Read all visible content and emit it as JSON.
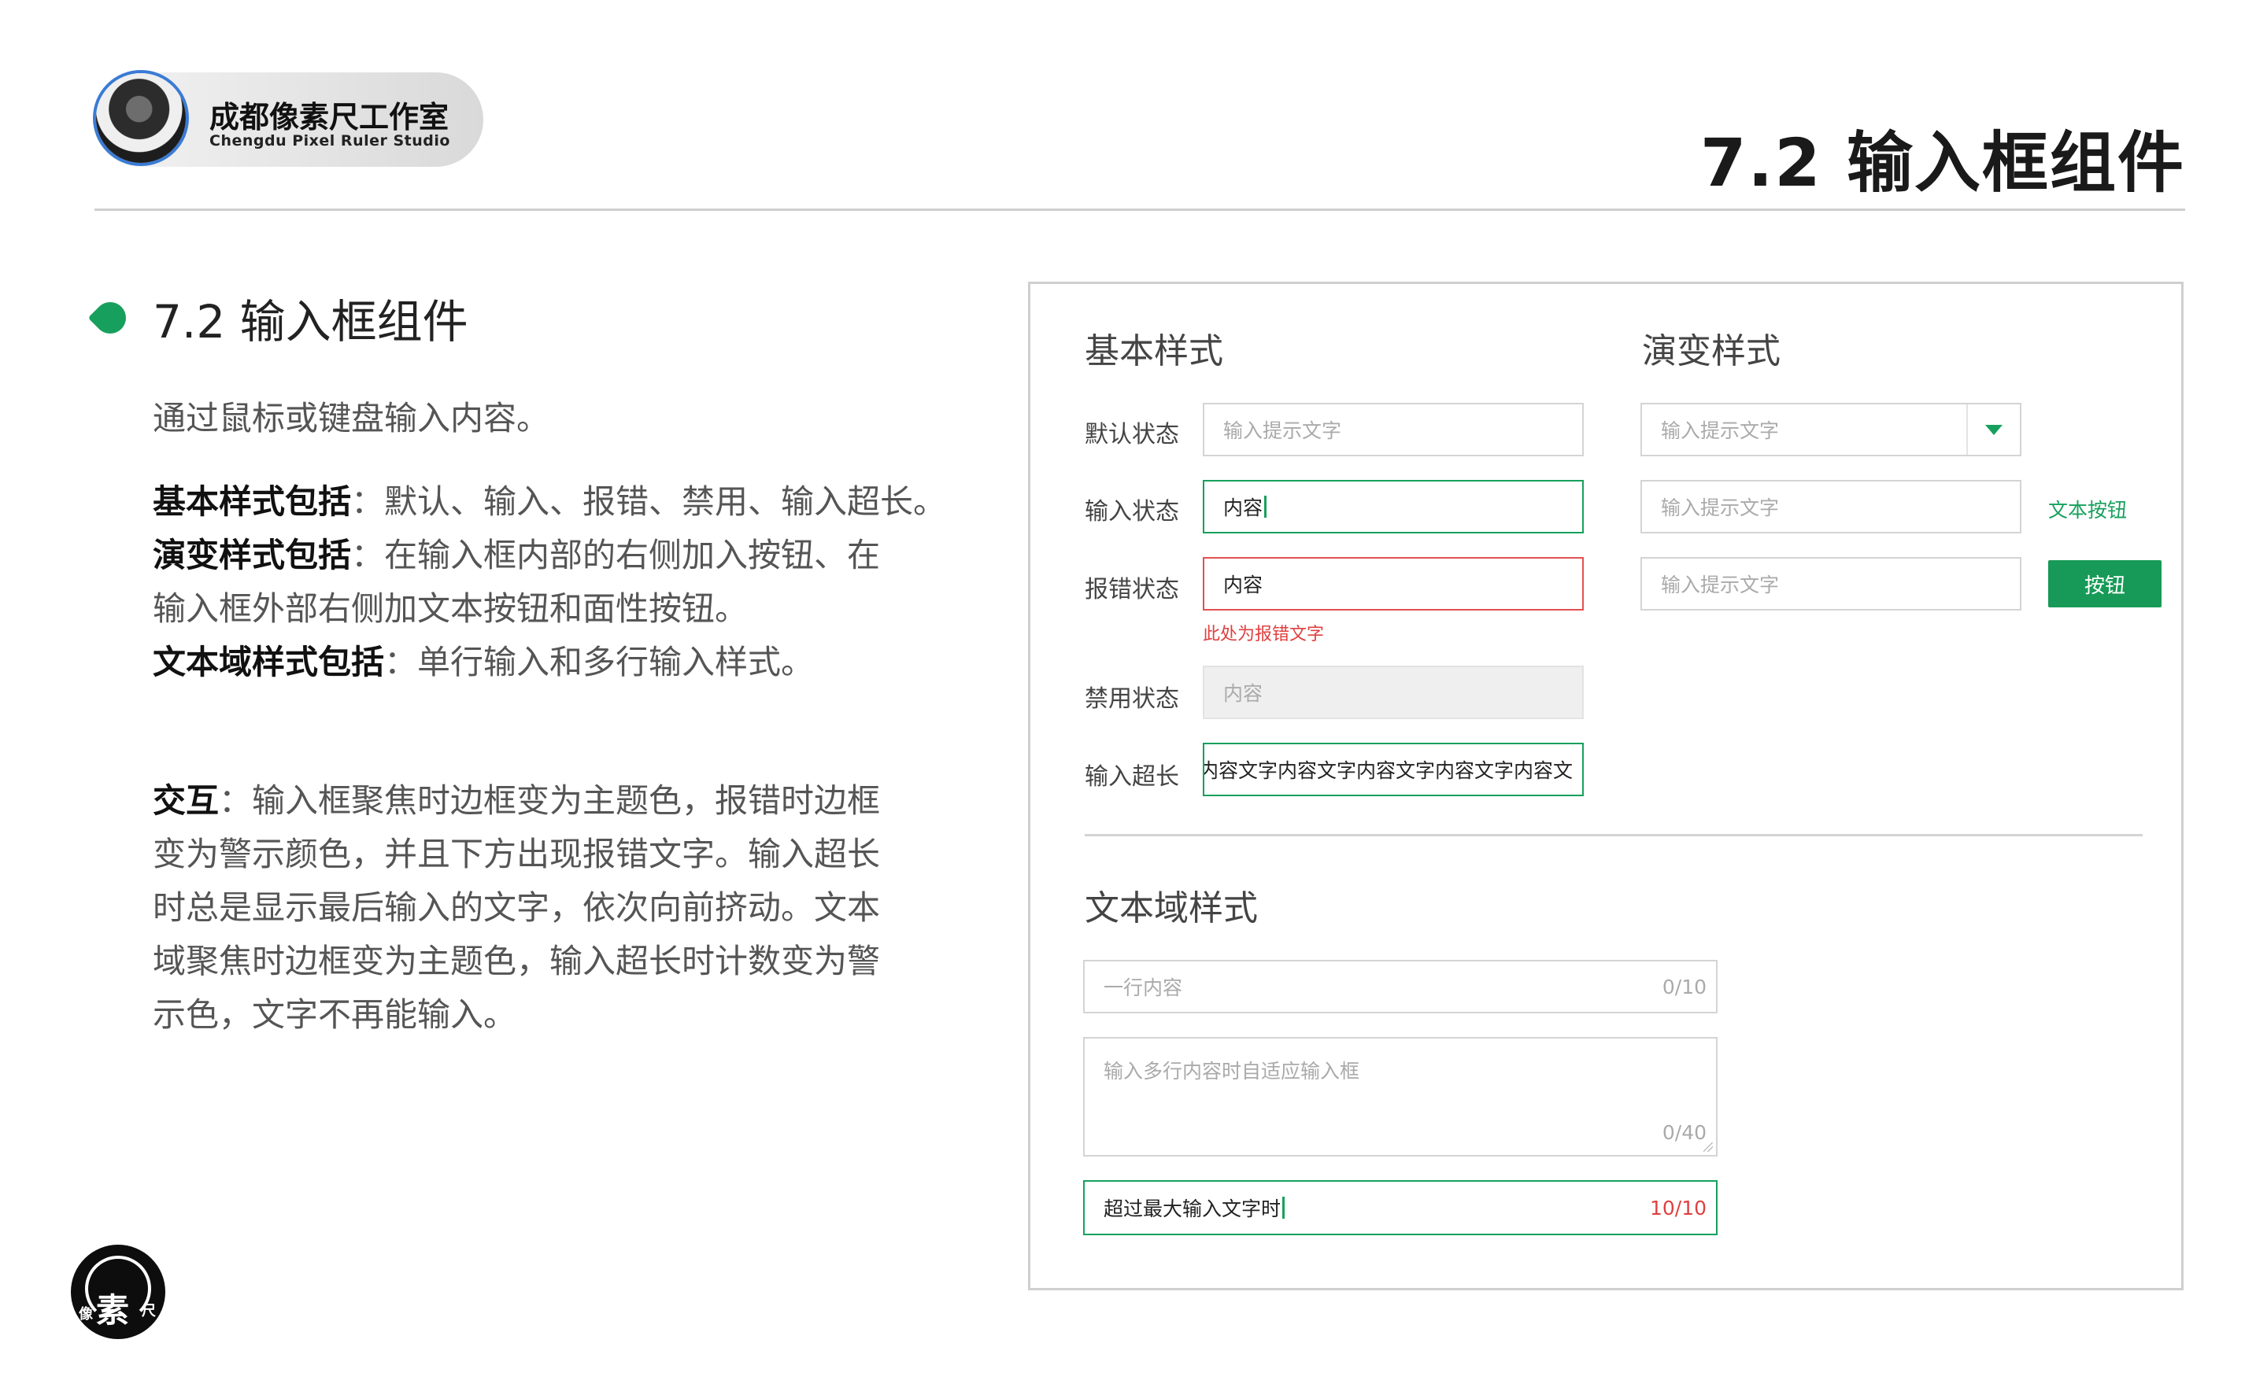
{
  "header": {
    "studio_name": "成都像素尺工作室",
    "studio_name_en": "Chengdu Pixel Ruler Studio",
    "page_title": "7.2 输入框组件"
  },
  "section": {
    "title": "7.2 输入框组件",
    "intro": "通过鼠标或键盘输入内容。",
    "basic_label": "基本样式包括",
    "basic_text": "：默认、输入、报错、禁用、输入超长。",
    "variant_label": "演变样式包括",
    "variant_text_1": "：在输入框内部的右侧加入按钮、在",
    "variant_text_2": "输入框外部右侧加文本按钮和面性按钮。",
    "textarea_label": "文本域样式包括",
    "textarea_text": "：单行输入和多行输入样式。",
    "interaction_label": "交互",
    "interaction_text_1": "：输入框聚焦时边框变为主题色，报错时边框",
    "interaction_text_2": "变为警示颜色，并且下方出现报错文字。输入超长",
    "interaction_text_3": "时总是显示最后输入的文字，依次向前挤动。文本",
    "interaction_text_4": "域聚焦时边框变为主题色，输入超长时计数变为警",
    "interaction_text_5": "示色，文字不再能输入。"
  },
  "panel": {
    "basic_heading": "基本样式",
    "variant_heading": "演变样式",
    "textarea_heading": "文本域样式",
    "rows": {
      "default_label": "默认状态",
      "default_placeholder": "输入提示文字",
      "input_label": "输入状态",
      "input_value": "内容",
      "error_label": "报错状态",
      "error_value": "内容",
      "error_message": "此处为报错文字",
      "disabled_label": "禁用状态",
      "disabled_value": "内容",
      "overflow_label": "输入超长",
      "overflow_value": "内容文字内容文字内容文字内容文字内容文"
    },
    "variants": {
      "select_placeholder": "输入提示文字",
      "text_button_placeholder": "输入提示文字",
      "text_button_label": "文本按钮",
      "button_placeholder": "输入提示文字",
      "button_label": "按钮"
    },
    "textareas": {
      "single_placeholder": "一行内容",
      "single_counter": "0/10",
      "multi_placeholder": "输入多行内容时自适应输入框",
      "multi_counter": "0/40",
      "over_value": "超过最大输入文字时",
      "over_counter": "10/10"
    }
  },
  "footer": {
    "logo_main": "素",
    "logo_left": "像",
    "logo_right": "尺"
  },
  "colors": {
    "theme_green": "#17a05d",
    "warning_red": "#e45050"
  }
}
